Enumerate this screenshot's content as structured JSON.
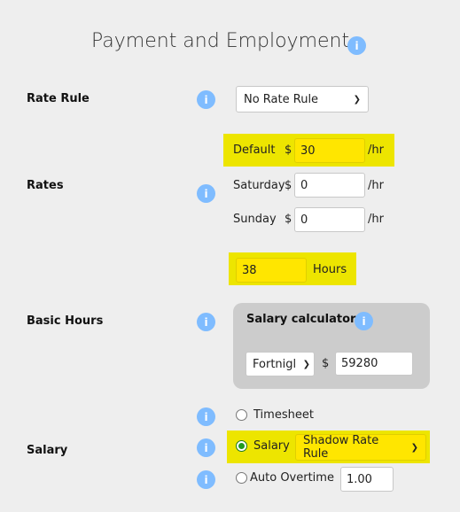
{
  "header": {
    "title": "Payment and Employment",
    "info_icon": "info-icon"
  },
  "rate_rule": {
    "label": "Rate Rule",
    "selected": "No Rate Rule"
  },
  "rates": {
    "label": "Rates",
    "currency": "$",
    "unit": "/hr",
    "rows": [
      {
        "name": "Default",
        "value": "30",
        "highlighted": true
      },
      {
        "name": "Saturday",
        "value": "0",
        "highlighted": false
      },
      {
        "name": "Sunday",
        "value": "0",
        "highlighted": false
      }
    ]
  },
  "basic_hours": {
    "label": "Basic Hours",
    "value": "38",
    "unit": "Hours",
    "calculator": {
      "title": "Salary calculator",
      "period": "Fortnigl",
      "currency": "$",
      "amount": "59280"
    }
  },
  "salary": {
    "label": "Salary",
    "options": [
      {
        "label": "Timesheet",
        "selected": false
      },
      {
        "label": "Salary",
        "selected": true,
        "rule": "Shadow Rate Rule"
      },
      {
        "label": "Auto Overtime",
        "selected": false,
        "value": "1.00"
      }
    ]
  },
  "colors": {
    "highlight": "#ede500",
    "info": "#7fbcff",
    "calculator_bg": "#cccccc"
  }
}
